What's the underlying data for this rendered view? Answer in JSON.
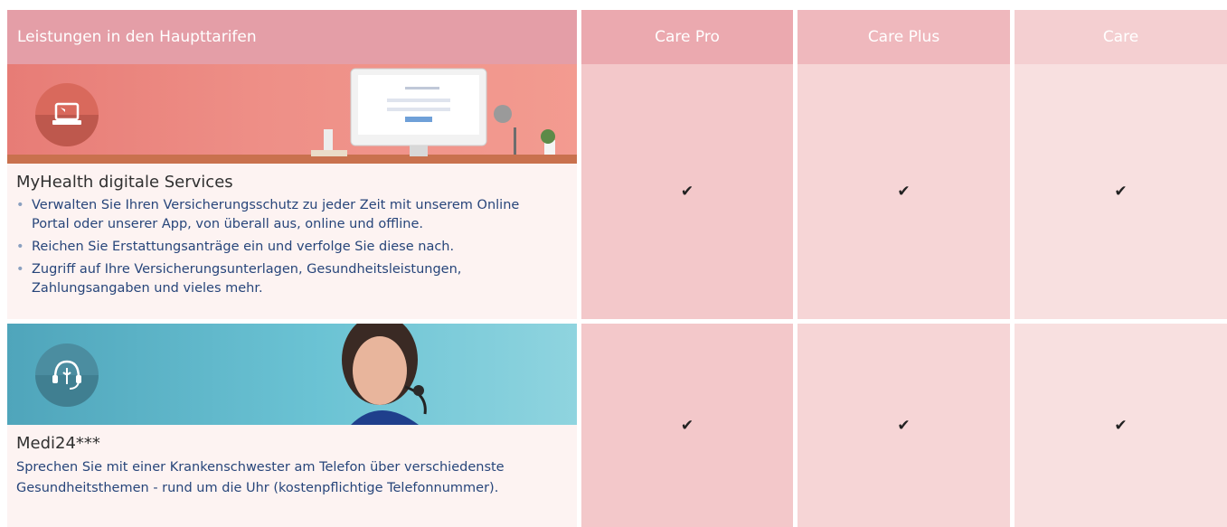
{
  "header": {
    "col0": "Leistungen in den Haupttarifen",
    "col1": "Care Pro",
    "col2": "Care Plus",
    "col3": "Care"
  },
  "rows": [
    {
      "icon": "laptop-icon",
      "title": "MyHealth digitale Services",
      "bullets": [
        "Verwalten Sie Ihren Versicherungsschutz zu jeder Zeit mit unserem Online Portal oder unserer App, von überall aus, online und offline.",
        "Reichen Sie Erstattungsanträge ein und verfolge Sie diese nach.",
        "Zugriff auf Ihre Versicherungsunterlagen, Gesundheitsleistungen, Zahlungsangaben und vieles mehr."
      ],
      "checks": [
        "✔",
        "✔",
        "✔"
      ]
    },
    {
      "icon": "medical-headset-icon",
      "title": "Medi24***",
      "description": "Sprechen Sie mit einer Krankenschwester am Telefon über verschiedenste Gesundheitsthemen - rund um die Uhr (kostenpflichtige Telefonnummer).",
      "checks": [
        "✔",
        "✔",
        "✔"
      ]
    }
  ]
}
